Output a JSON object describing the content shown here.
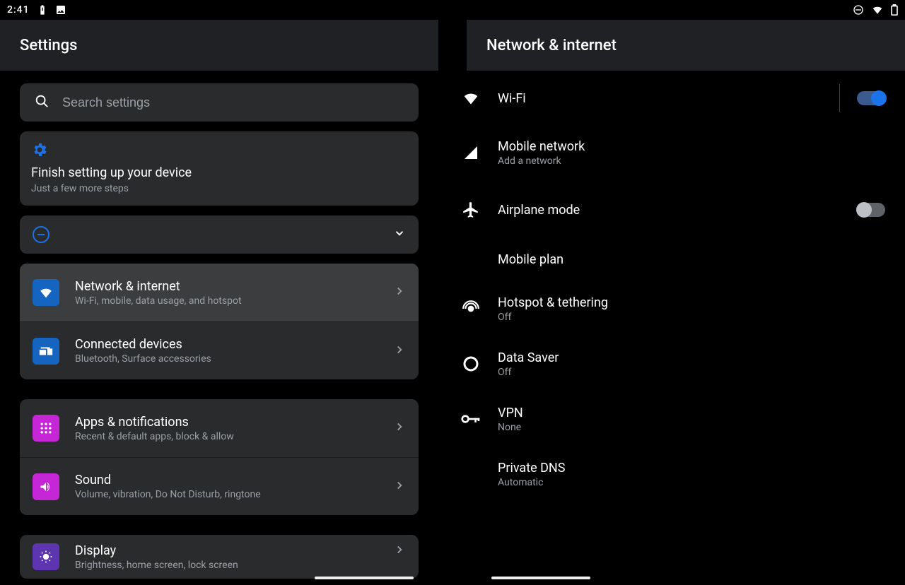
{
  "statusbar": {
    "time": "2:41"
  },
  "left": {
    "title": "Settings",
    "search_placeholder": "Search settings",
    "setup": {
      "title": "Finish setting up your device",
      "subtitle": "Just a few more steps"
    },
    "items": [
      {
        "title": "Network & internet",
        "subtitle": "Wi-Fi, mobile, data usage, and hotspot",
        "icon": "wifi",
        "color": "blue",
        "selected": true
      },
      {
        "title": "Connected devices",
        "subtitle": "Bluetooth, Surface accessories",
        "icon": "devices",
        "color": "blue"
      },
      {
        "title": "Apps & notifications",
        "subtitle": "Recent & default apps, block & allow",
        "icon": "apps",
        "color": "magenta"
      },
      {
        "title": "Sound",
        "subtitle": "Volume, vibration, Do Not Disturb, ringtone",
        "icon": "volume",
        "color": "magenta"
      },
      {
        "title": "Display",
        "subtitle": "Brightness, home screen, lock screen",
        "icon": "brightness",
        "color": "violet"
      }
    ]
  },
  "right": {
    "title": "Network & internet",
    "rows": [
      {
        "title": "Wi-Fi",
        "subtitle": "",
        "icon": "wifi",
        "toggle": true,
        "on": true,
        "divider": true
      },
      {
        "title": "Mobile network",
        "subtitle": "Add a network",
        "icon": "signal"
      },
      {
        "title": "Airplane mode",
        "subtitle": "",
        "icon": "airplane",
        "toggle": true,
        "on": false
      },
      {
        "title": "Mobile plan",
        "subtitle": "",
        "icon": ""
      },
      {
        "title": "Hotspot & tethering",
        "subtitle": "Off",
        "icon": "hotspot"
      },
      {
        "title": "Data Saver",
        "subtitle": "Off",
        "icon": "datasaver"
      },
      {
        "title": "VPN",
        "subtitle": "None",
        "icon": "vpn"
      },
      {
        "title": "Private DNS",
        "subtitle": "Automatic",
        "icon": ""
      }
    ]
  }
}
